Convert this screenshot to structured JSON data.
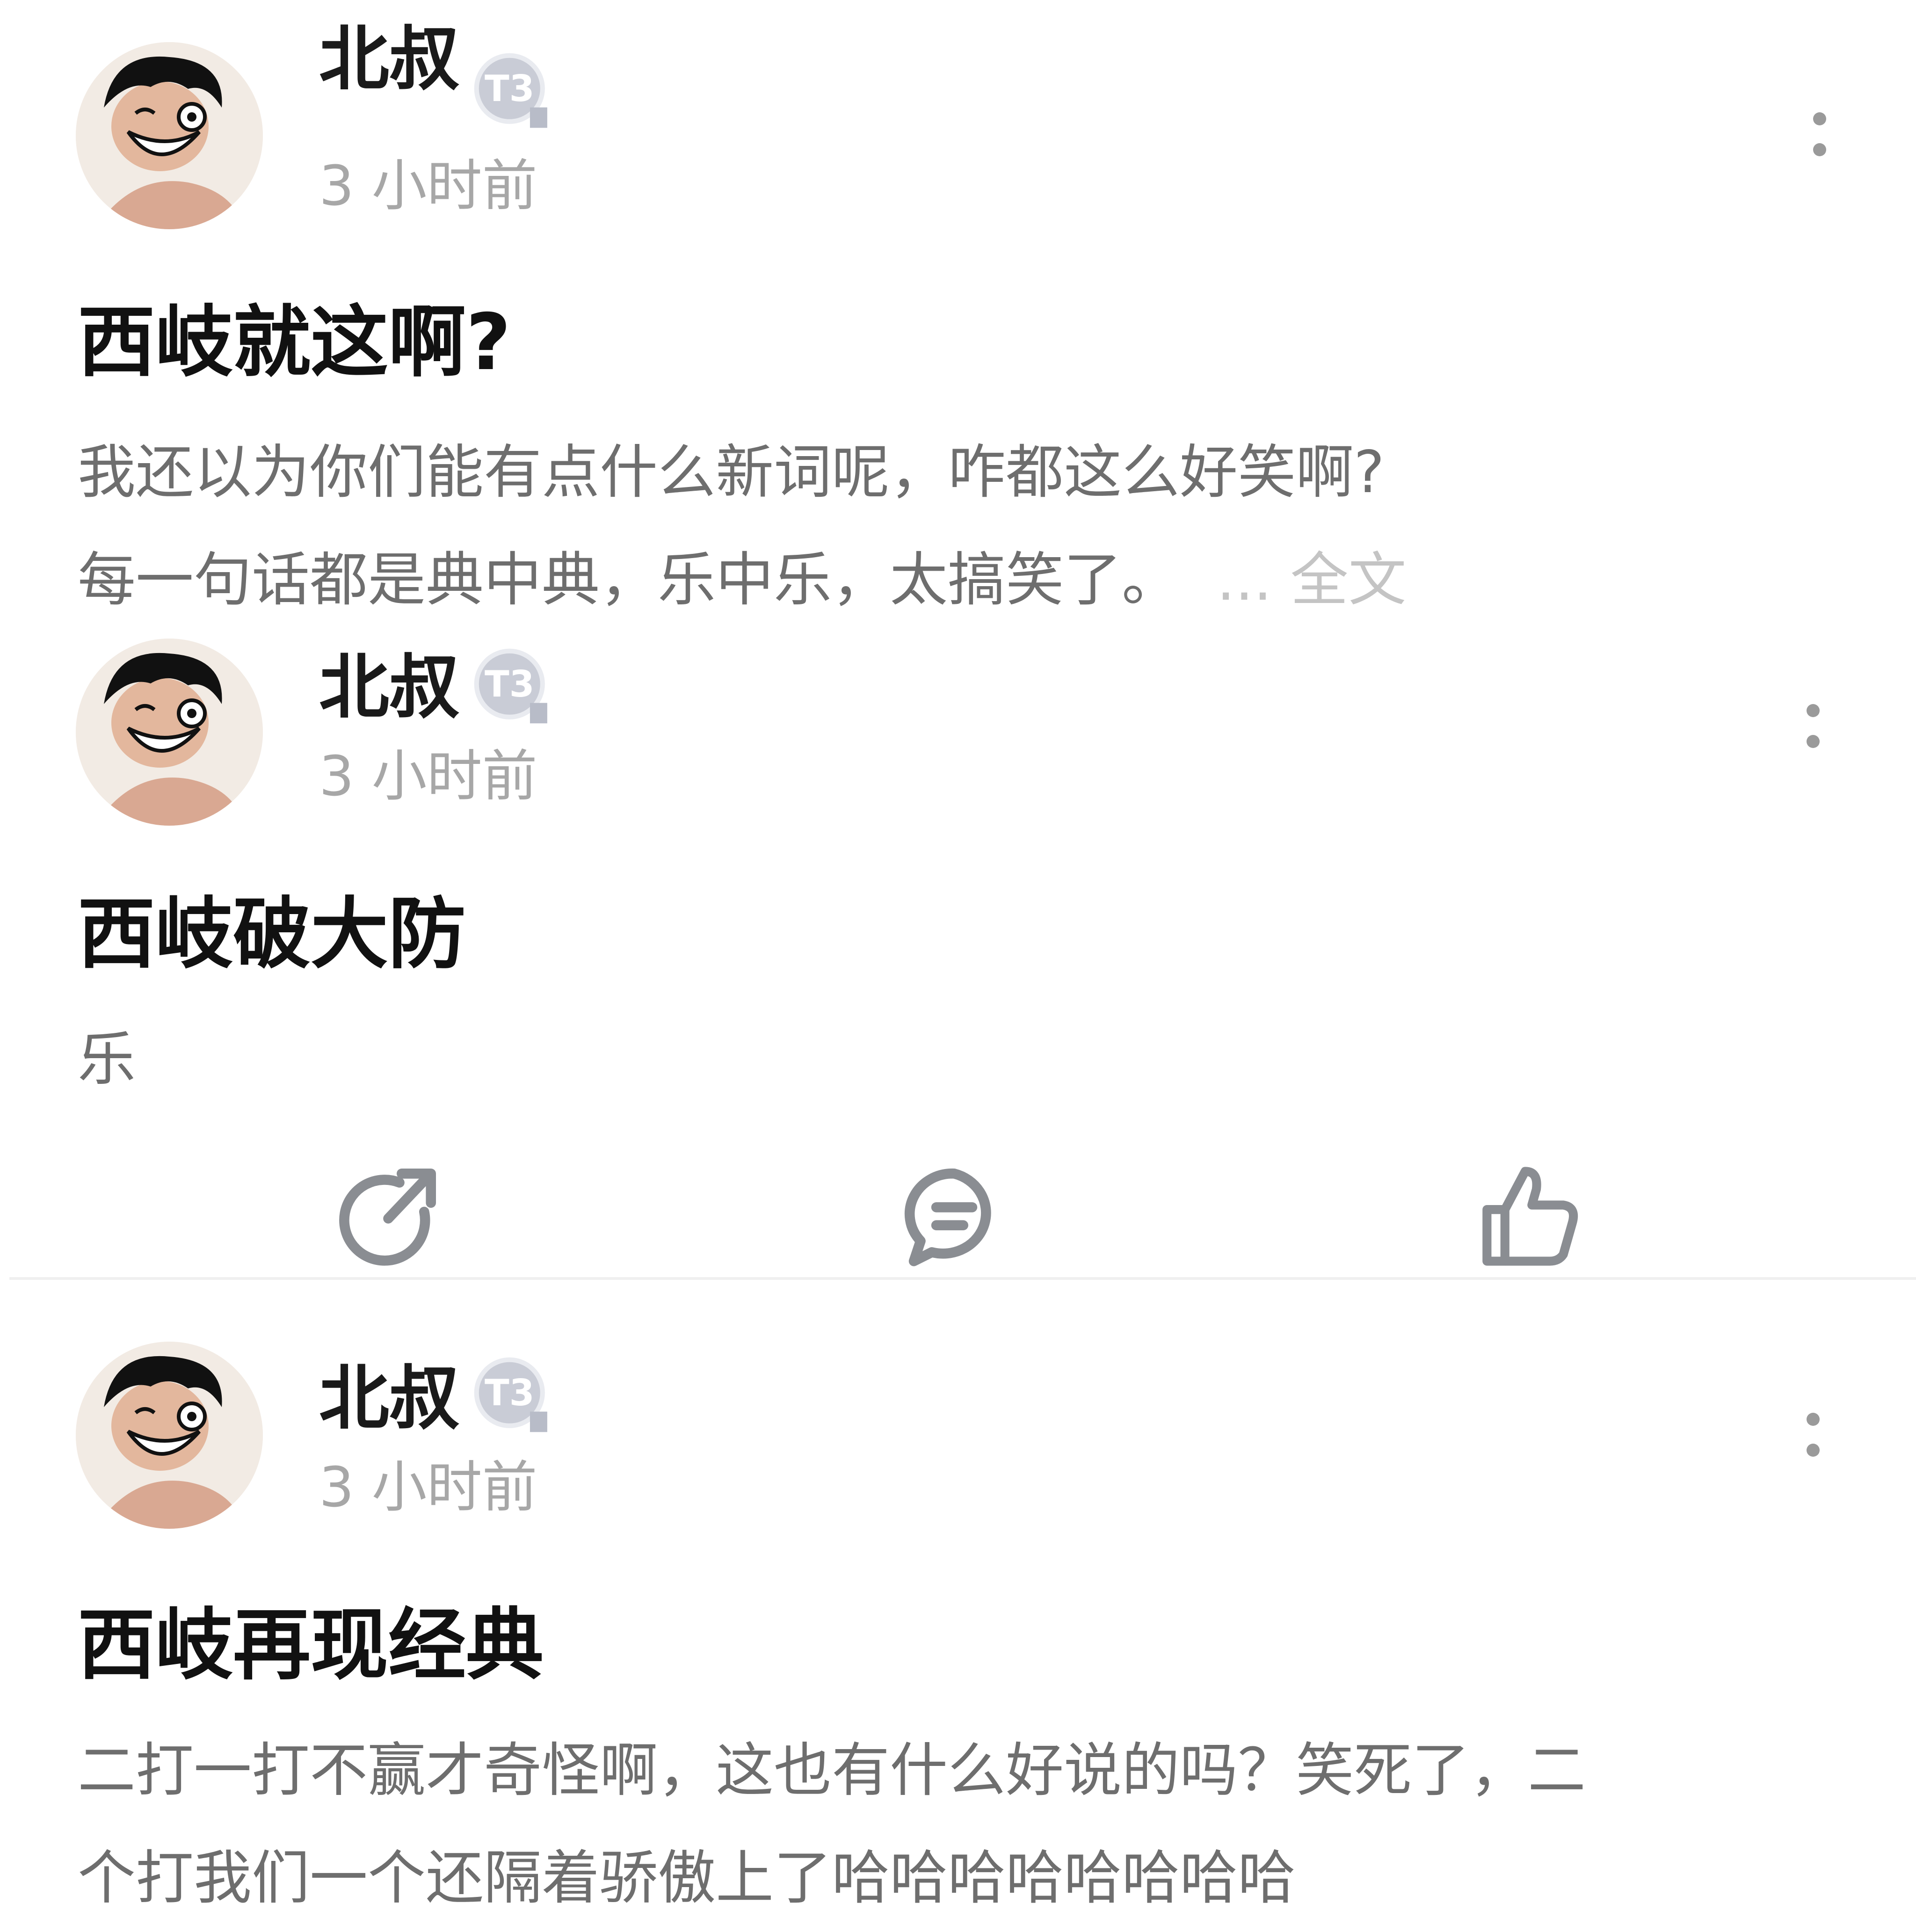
{
  "posts": [
    {
      "username": "北叔",
      "badge_label": "T3",
      "time": "3 小时前",
      "title": "西岐就这啊?",
      "body_lines": [
        "我还以为你们能有点什么新词呢，咋都这么好笑啊?",
        "每一句话都是典中典，乐中乐，太搞笑了。"
      ],
      "more_label": "... 全文"
    },
    {
      "username": "北叔",
      "badge_label": "T3",
      "time": "3 小时前",
      "title": "西岐破大防",
      "body_lines": [
        "乐"
      ]
    },
    {
      "username": "北叔",
      "badge_label": "T3",
      "time": "3 小时前",
      "title": "西岐再现经典",
      "body_lines": [
        "二打一打不赢才奇怪啊，这也有什么好说的吗？笑死了，二",
        "个打我们一个还隔着骄傲上了哈哈哈哈哈哈哈哈"
      ]
    }
  ],
  "actions": [
    {
      "icon": "share-icon"
    },
    {
      "icon": "comment-icon"
    },
    {
      "icon": "thumbs-up-icon"
    }
  ],
  "colors": {
    "username": "#1a1a1a",
    "time": "#a7a7a7",
    "body": "#6e6e6e",
    "more_link": "#c4c4c4",
    "icon": "#8a8d92"
  }
}
